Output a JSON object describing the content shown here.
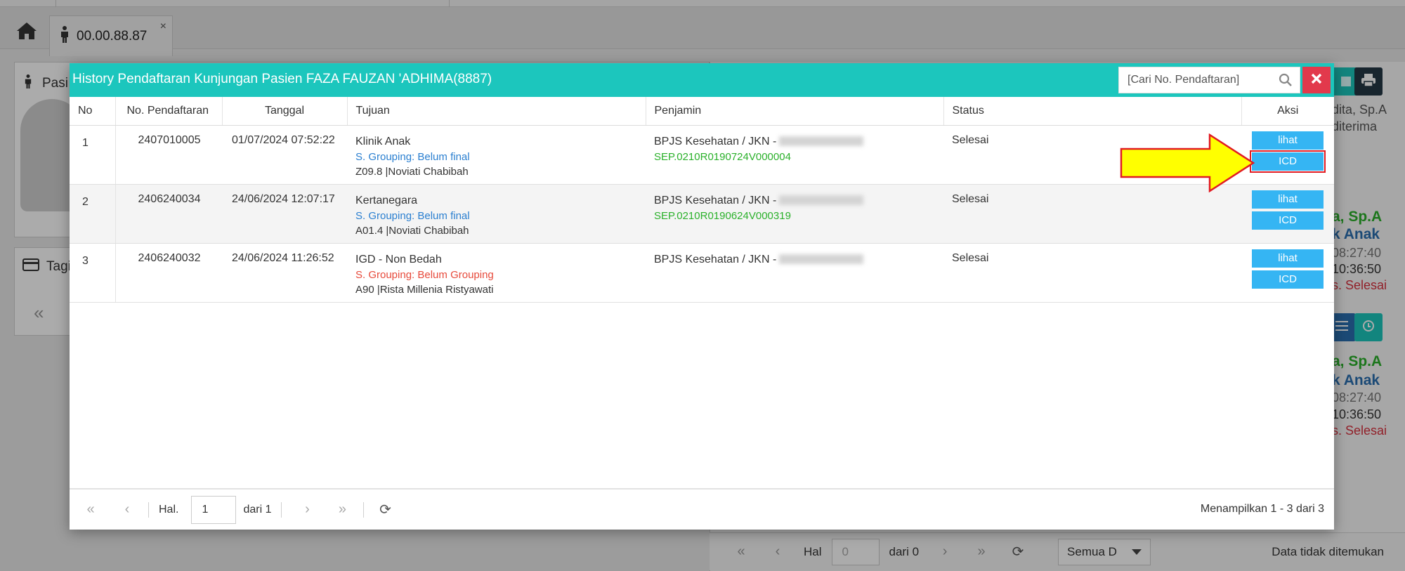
{
  "tabs": {
    "patient_tab_label": "00.00.88.87",
    "close_glyph": "×"
  },
  "background": {
    "left_panel_title": "Pasi",
    "billing_panel_title": "Tagi",
    "right_lines_1": [
      "dita, Sp.A",
      "diterima"
    ],
    "right_block_1": {
      "doctor": "a, Sp.A",
      "clinic": "k Anak",
      "time1": "08:27:40",
      "time2": "10:36:50",
      "status": "s. Selesai"
    },
    "right_block_2": {
      "doctor": "a, Sp.A",
      "clinic": "k Anak",
      "time1": "08:27:40",
      "time2": "10:36:50",
      "status": "s. Selesai"
    },
    "pager": {
      "page_label": "Hal",
      "page_value": "0",
      "of_label": "dari 0",
      "filter_value": "Semua D",
      "empty_text": "Data tidak ditemukan"
    },
    "colors": {
      "green": "#2bb12b",
      "blue": "#2a6fb0",
      "red": "#d9303e",
      "teal": "#1cc6bd",
      "dark": "#243845"
    }
  },
  "modal": {
    "title": "History Pendaftaran Kunjungan Pasien FAZA FAUZAN 'ADHIMA(8887)",
    "search_placeholder": "[Cari No. Pendaftaran]",
    "columns": [
      "No",
      "No. Pendaftaran",
      "Tanggal",
      "Tujuan",
      "Penjamin",
      "Status",
      "Aksi"
    ],
    "rows": [
      {
        "no": "1",
        "reg_no": "2407010005",
        "date": "01/07/2024 07:52:22",
        "dest": "Klinik Anak",
        "grouping": "S. Grouping: Belum final",
        "grouping_state": "final",
        "diag": "Z09.8 |Noviati Chabibah",
        "payer": "BPJS Kesehatan / JKN -",
        "sep": "SEP.0210R0190724V000004",
        "status": "Selesai",
        "btn_view": "lihat",
        "btn_icd": "ICD"
      },
      {
        "no": "2",
        "reg_no": "2406240034",
        "date": "24/06/2024 12:07:17",
        "dest": "Kertanegara",
        "grouping": "S. Grouping: Belum final",
        "grouping_state": "final",
        "diag": "A01.4 |Noviati Chabibah",
        "payer": "BPJS Kesehatan / JKN -",
        "sep": "SEP.0210R0190624V000319",
        "status": "Selesai",
        "btn_view": "lihat",
        "btn_icd": "ICD"
      },
      {
        "no": "3",
        "reg_no": "2406240032",
        "date": "24/06/2024 11:26:52",
        "dest": "IGD - Non Bedah",
        "grouping": "S. Grouping: Belum Grouping",
        "grouping_state": "none",
        "diag": "A90 |Rista Millenia Ristyawati",
        "payer": "BPJS Kesehatan / JKN -",
        "sep": "",
        "status": "Selesai",
        "btn_view": "lihat",
        "btn_icd": "ICD"
      }
    ],
    "footer": {
      "page_label": "Hal.",
      "page_value": "1",
      "of_label": "dari 1",
      "info": "Menampilkan 1 - 3 dari 3"
    },
    "colors": {
      "header": "#1cc6bd",
      "close": "#e2394c",
      "button": "#35b5f3",
      "annotation_arrow": "#ffff00",
      "annotation_border": "#e11b22"
    }
  },
  "icons": [
    "home-icon",
    "person-icon",
    "close-icon",
    "search-icon",
    "card-icon",
    "print-icon",
    "history-icon",
    "list-icon",
    "refresh-icon",
    "first-page-icon",
    "prev-page-icon",
    "next-page-icon",
    "last-page-icon",
    "arrow-annotation"
  ]
}
